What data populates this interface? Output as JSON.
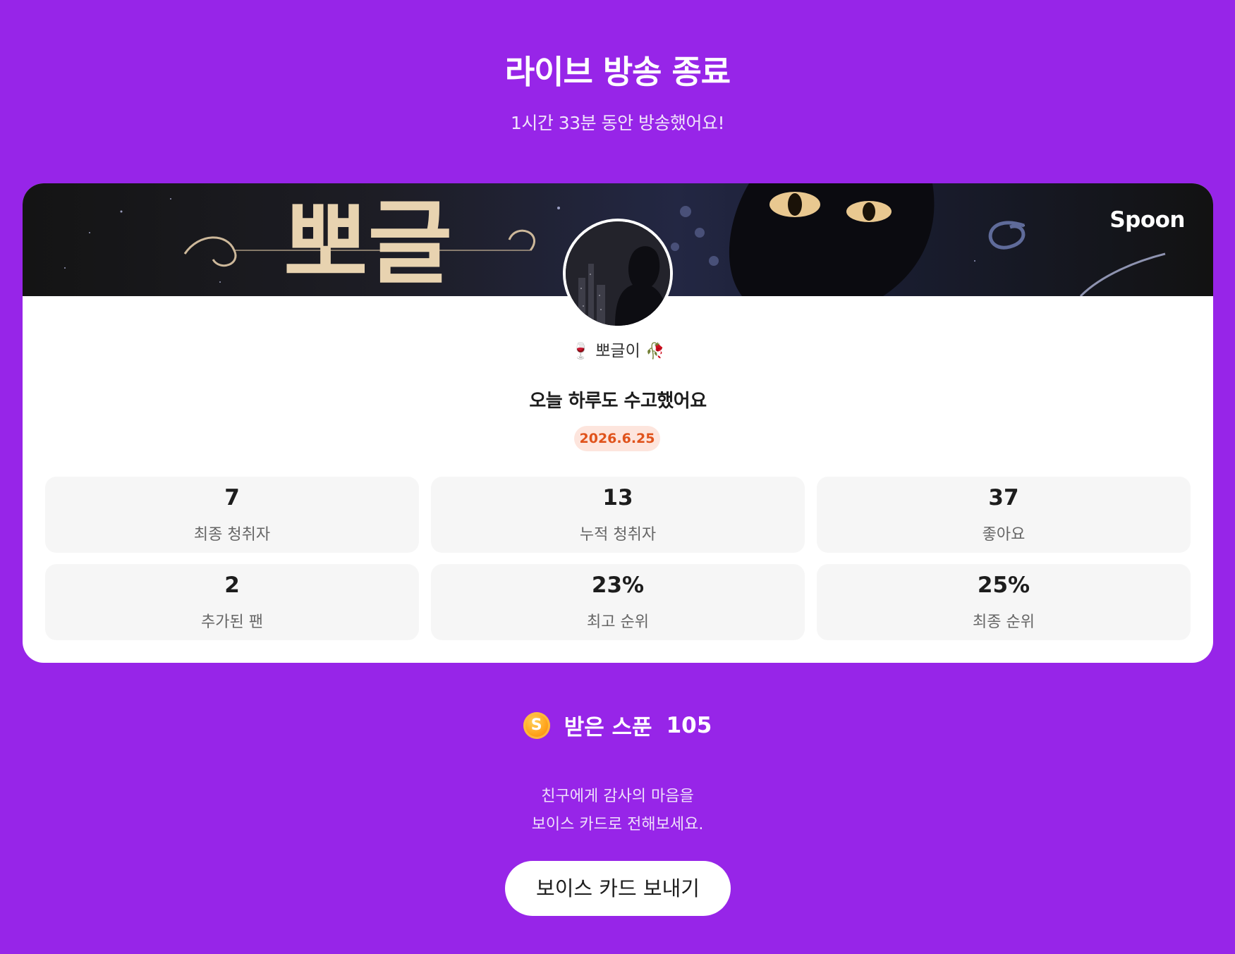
{
  "header": {
    "title": "라이브 방송 종료",
    "subtitle": "1시간 33분 동안 방송했어요!"
  },
  "card": {
    "brand": "Spoon",
    "banner_text": "뽀글",
    "nickname": {
      "prefix_emoji": "🍷",
      "name": "뽀글이",
      "suffix_emoji": "🥀"
    },
    "message": "오늘 하루도 수고했어요",
    "date": "2026.6.25",
    "stats": [
      {
        "value": "7",
        "label": "최종 청취자"
      },
      {
        "value": "13",
        "label": "누적 청취자"
      },
      {
        "value": "37",
        "label": "좋아요"
      },
      {
        "value": "2",
        "label": "추가된 팬"
      },
      {
        "value": "23%",
        "label": "최고 순위"
      },
      {
        "value": "25%",
        "label": "최종 순위"
      }
    ]
  },
  "spoons": {
    "coin_symbol": "S",
    "label": "받은 스푼",
    "count": "105"
  },
  "thanks": {
    "line1": "친구에게 감사의 마음을",
    "line2": "보이스 카드로 전해보세요."
  },
  "action": {
    "button_label": "보이스 카드 보내기"
  },
  "colors": {
    "background": "#9725e8",
    "date_badge_bg": "#fde5dd",
    "date_badge_text": "#e0531c",
    "stat_bg": "#f6f6f6"
  }
}
